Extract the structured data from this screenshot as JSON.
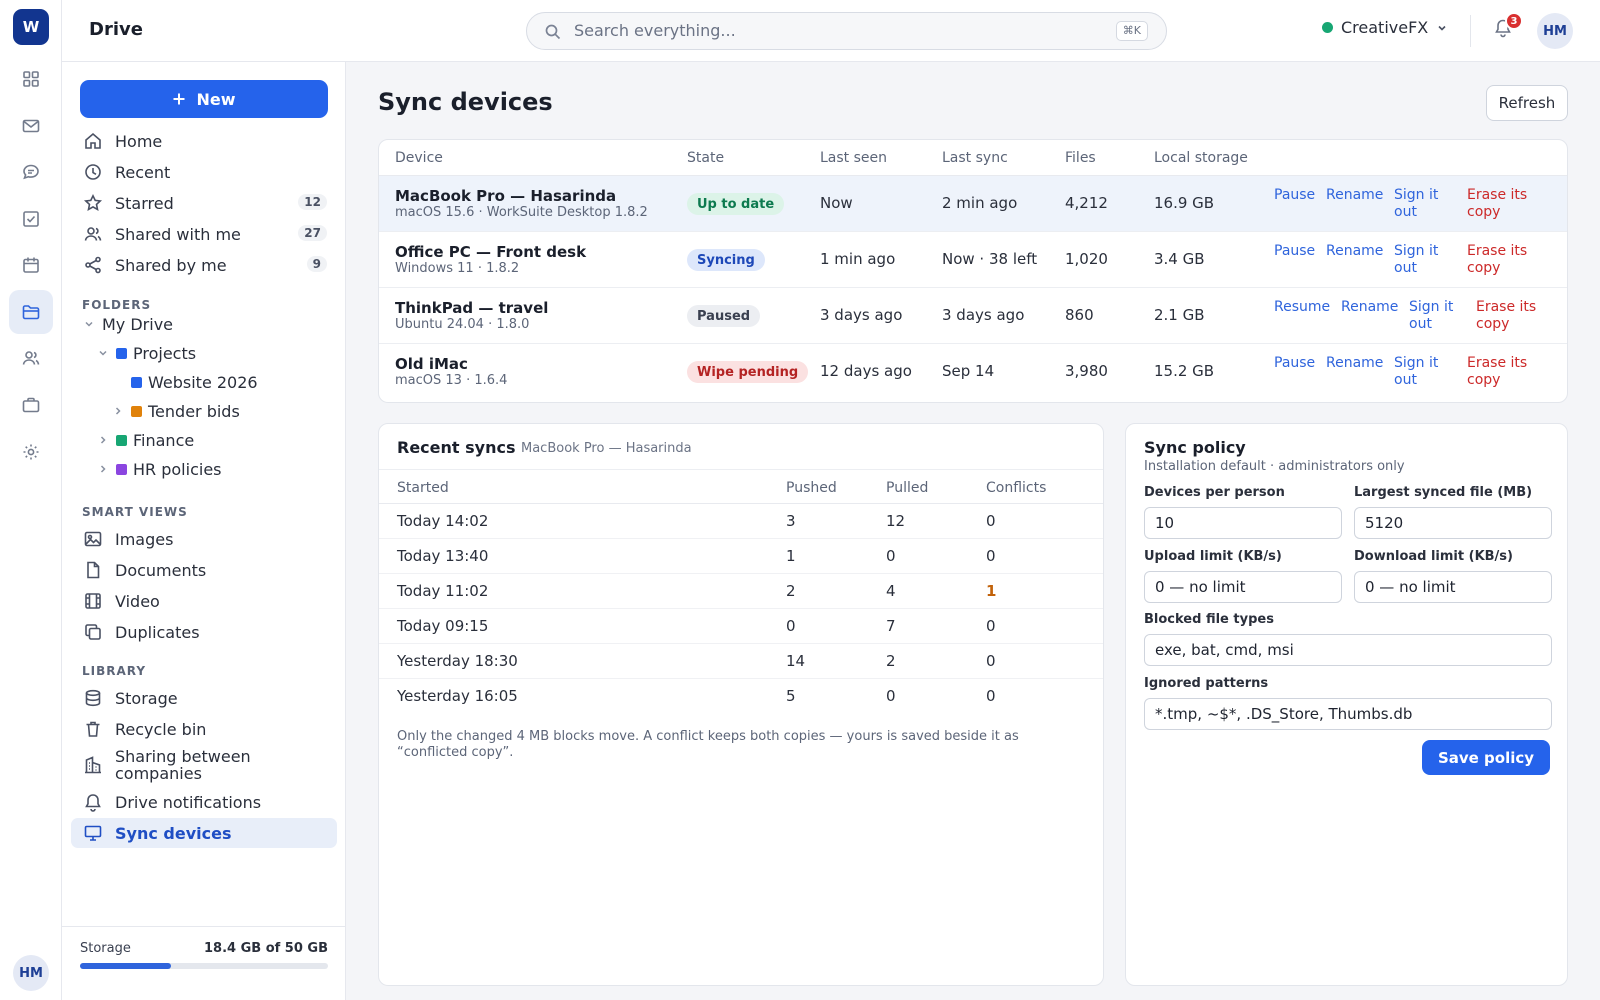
{
  "app": {
    "logo_letter": "W",
    "title": "Drive",
    "avatar": "HM"
  },
  "search": {
    "placeholder": "Search everything...",
    "shortcut": "⌘K"
  },
  "org": {
    "name": "CreativeFX",
    "status_color": "#17a673"
  },
  "notifications": {
    "count": "3"
  },
  "rail": {
    "icons": [
      "grid-icon",
      "mail-icon",
      "chat-icon",
      "tasks-icon",
      "calendar-icon",
      "folder-icon",
      "people-icon",
      "briefcase-icon",
      "settings-icon"
    ],
    "active": "folder-icon"
  },
  "sidebar": {
    "new_label": "New",
    "nav": [
      {
        "label": "Home",
        "icon": "home-icon"
      },
      {
        "label": "Recent",
        "icon": "clock-icon"
      },
      {
        "label": "Starred",
        "icon": "star-icon",
        "count": "12"
      },
      {
        "label": "Shared with me",
        "icon": "users-icon",
        "count": "27"
      },
      {
        "label": "Shared by me",
        "icon": "share-icon",
        "count": "9"
      }
    ],
    "folders_heading": "FOLDERS",
    "folders": [
      {
        "label": "My Drive"
      },
      {
        "label": "Projects",
        "color": "#2563eb"
      },
      {
        "label": "Website 2026",
        "color": "#2563eb"
      },
      {
        "label": "Tender bids",
        "color": "#e0820b"
      },
      {
        "label": "Finance",
        "color": "#17a673"
      },
      {
        "label": "HR policies",
        "color": "#8b45e0"
      }
    ],
    "smart_heading": "SMART VIEWS",
    "smart": [
      {
        "label": "Images",
        "icon": "image-icon"
      },
      {
        "label": "Documents",
        "icon": "document-icon"
      },
      {
        "label": "Video",
        "icon": "film-icon"
      },
      {
        "label": "Duplicates",
        "icon": "copy-icon"
      }
    ],
    "library_heading": "LIBRARY",
    "library": [
      {
        "label": "Storage",
        "icon": "database-icon"
      },
      {
        "label": "Recycle bin",
        "icon": "trash-icon"
      },
      {
        "label": "Sharing between companies",
        "icon": "building-icon"
      },
      {
        "label": "Drive notifications",
        "icon": "bell-icon"
      },
      {
        "label": "Sync devices",
        "icon": "monitor-icon",
        "active": true
      }
    ],
    "storage": {
      "label": "Storage",
      "value": "18.4 GB of 50 GB",
      "used_fraction": 0.368
    }
  },
  "page": {
    "title": "Sync devices",
    "refresh_label": "Refresh"
  },
  "devices": {
    "columns": [
      "Device",
      "State",
      "Last seen",
      "Last sync",
      "Files",
      "Local storage"
    ],
    "rows": [
      {
        "name": "MacBook Pro — Hasarinda",
        "sub": "macOS 15.6 · WorkSuite Desktop 1.8.2",
        "state": "Up to date",
        "state_kind": "ok",
        "last_seen": "Now",
        "last_sync": "2 min ago",
        "files": "4,212",
        "storage": "16.9 GB",
        "actions": [
          "Pause",
          "Rename",
          "Sign it out",
          "Erase its copy"
        ]
      },
      {
        "name": "Office PC — Front desk",
        "sub": "Windows 11 · 1.8.2",
        "state": "Syncing",
        "state_kind": "info",
        "last_seen": "1 min ago",
        "last_sync": "Now · 38 left",
        "files": "1,020",
        "storage": "3.4 GB",
        "actions": [
          "Pause",
          "Rename",
          "Sign it out",
          "Erase its copy"
        ]
      },
      {
        "name": "ThinkPad — travel",
        "sub": "Ubuntu 24.04 · 1.8.0",
        "state": "Paused",
        "state_kind": "muted",
        "last_seen": "3 days ago",
        "last_sync": "3 days ago",
        "files": "860",
        "storage": "2.1 GB",
        "actions": [
          "Resume",
          "Rename",
          "Sign it out",
          "Erase its copy"
        ]
      },
      {
        "name": "Old iMac",
        "sub": "macOS 13 · 1.6.4",
        "state": "Wipe pending",
        "state_kind": "danger",
        "last_seen": "12 days ago",
        "last_sync": "Sep 14",
        "files": "3,980",
        "storage": "15.2 GB",
        "actions": [
          "Pause",
          "Rename",
          "Sign it out",
          "Erase its copy"
        ]
      }
    ]
  },
  "recent_syncs": {
    "title": "Recent syncs",
    "device": "MacBook Pro — Hasarinda",
    "columns": [
      "Started",
      "Pushed",
      "Pulled",
      "Conflicts"
    ],
    "rows": [
      {
        "started": "Today 14:02",
        "pushed": "3",
        "pulled": "12",
        "conflicts": "0"
      },
      {
        "started": "Today 13:40",
        "pushed": "1",
        "pulled": "0",
        "conflicts": "0"
      },
      {
        "started": "Today 11:02",
        "pushed": "2",
        "pulled": "4",
        "conflicts": "1"
      },
      {
        "started": "Today 09:15",
        "pushed": "0",
        "pulled": "7",
        "conflicts": "0"
      },
      {
        "started": "Yesterday 18:30",
        "pushed": "14",
        "pulled": "2",
        "conflicts": "0"
      },
      {
        "started": "Yesterday 16:05",
        "pushed": "5",
        "pulled": "0",
        "conflicts": "0"
      }
    ],
    "note": "Only the changed 4 MB blocks move. A conflict keeps both copies — yours is saved beside it as “conflicted copy”."
  },
  "policy": {
    "title": "Sync policy",
    "subtitle": "Installation default · administrators only",
    "devices_per_person": {
      "label": "Devices per person",
      "value": "10"
    },
    "largest_file": {
      "label": "Largest synced file (MB)",
      "value": "5120"
    },
    "upload_limit": {
      "label": "Upload limit (KB/s)",
      "value": "0 — no limit"
    },
    "download_limit": {
      "label": "Download limit (KB/s)",
      "value": "0 — no limit"
    },
    "blocked_types": {
      "label": "Blocked file types",
      "value": "exe, bat, cmd, msi"
    },
    "ignored_patterns": {
      "label": "Ignored patterns",
      "value": "*.tmp, ~$*, .DS_Store, Thumbs.db"
    },
    "save_label": "Save policy"
  },
  "colors": {
    "accent": "#2563eb",
    "ok": "#17a673",
    "danger": "#cc2929",
    "conflict": "#c2620a"
  }
}
